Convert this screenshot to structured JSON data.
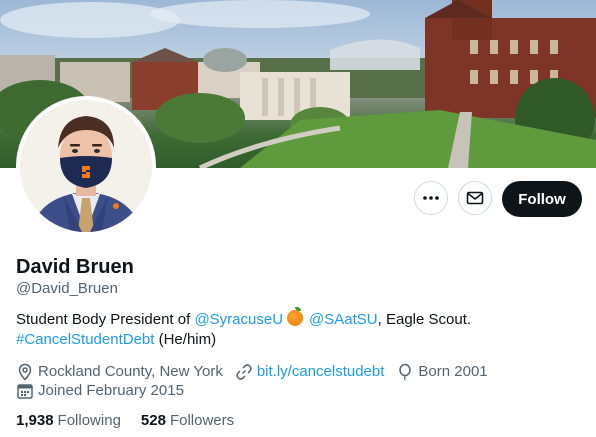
{
  "profile": {
    "name": "David Bruen",
    "handle": "@David_Bruen"
  },
  "actions": {
    "more_icon": "more-horizontal-icon",
    "message_icon": "mail-icon",
    "follow_label": "Follow"
  },
  "bio": {
    "prefix": "Student Body President of ",
    "mention_1": "@SyracuseU",
    "mention_2": "@SAatSU",
    "suffix": ", Eagle Scout.",
    "hashtag": "#CancelStudentDebt",
    "pronouns": " (He/him)"
  },
  "meta": {
    "location": "Rockland County, New York",
    "website": "bit.ly/cancelstudebt",
    "birth": "Born 2001",
    "joined": "Joined February 2015"
  },
  "stats": {
    "following_count": "1,938",
    "following_label": "Following",
    "followers_count": "528",
    "followers_label": "Followers"
  },
  "colors": {
    "accent": "#1d9bf0",
    "text_primary": "#0f1419",
    "text_secondary": "#536471",
    "follow_bg": "#0f1419"
  }
}
